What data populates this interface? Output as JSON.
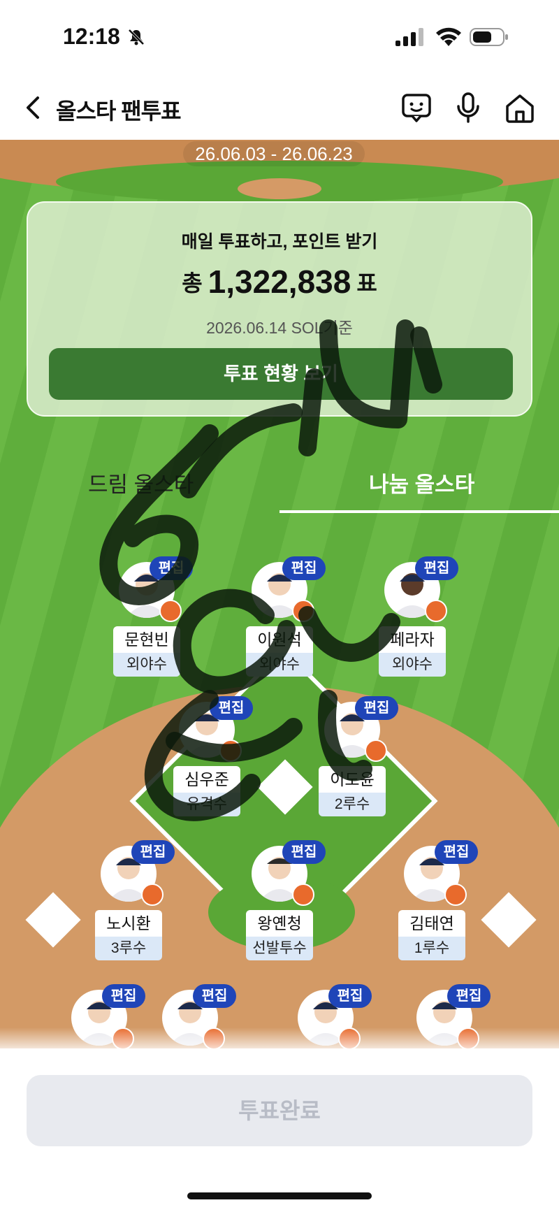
{
  "status": {
    "time": "12:18"
  },
  "header": {
    "title": "올스타 팬투표"
  },
  "banner": {
    "dates": "26.06.03 - 26.06.23"
  },
  "card": {
    "subtitle": "매일 투표하고, 포인트 받기",
    "total_prefix": "총",
    "total_votes": "1,322,838",
    "total_suffix": "표",
    "date_note": "2026.06.14 SOL기준",
    "button_label": "투표 현황 보기"
  },
  "tabs": [
    {
      "label": "드림 올스타",
      "active": false
    },
    {
      "label": "나눔 올스타",
      "active": true
    }
  ],
  "edit_label": "편집",
  "players": [
    {
      "name": "문현빈",
      "position": "외야수"
    },
    {
      "name": "이원석",
      "position": "외야수"
    },
    {
      "name": "페라자",
      "position": "외야수"
    },
    {
      "name": "심우준",
      "position": "유격수"
    },
    {
      "name": "이도윤",
      "position": "2루수"
    },
    {
      "name": "노시환",
      "position": "3루수"
    },
    {
      "name": "왕옌청",
      "position": "선발투수"
    },
    {
      "name": "김태연",
      "position": "1루수"
    }
  ],
  "footer": {
    "button_label": "투표완료"
  },
  "colors": {
    "accent": "#1f45b8",
    "card_button": "#3a7a32",
    "field": "#5fae3c",
    "dirt": "#d39a66"
  }
}
